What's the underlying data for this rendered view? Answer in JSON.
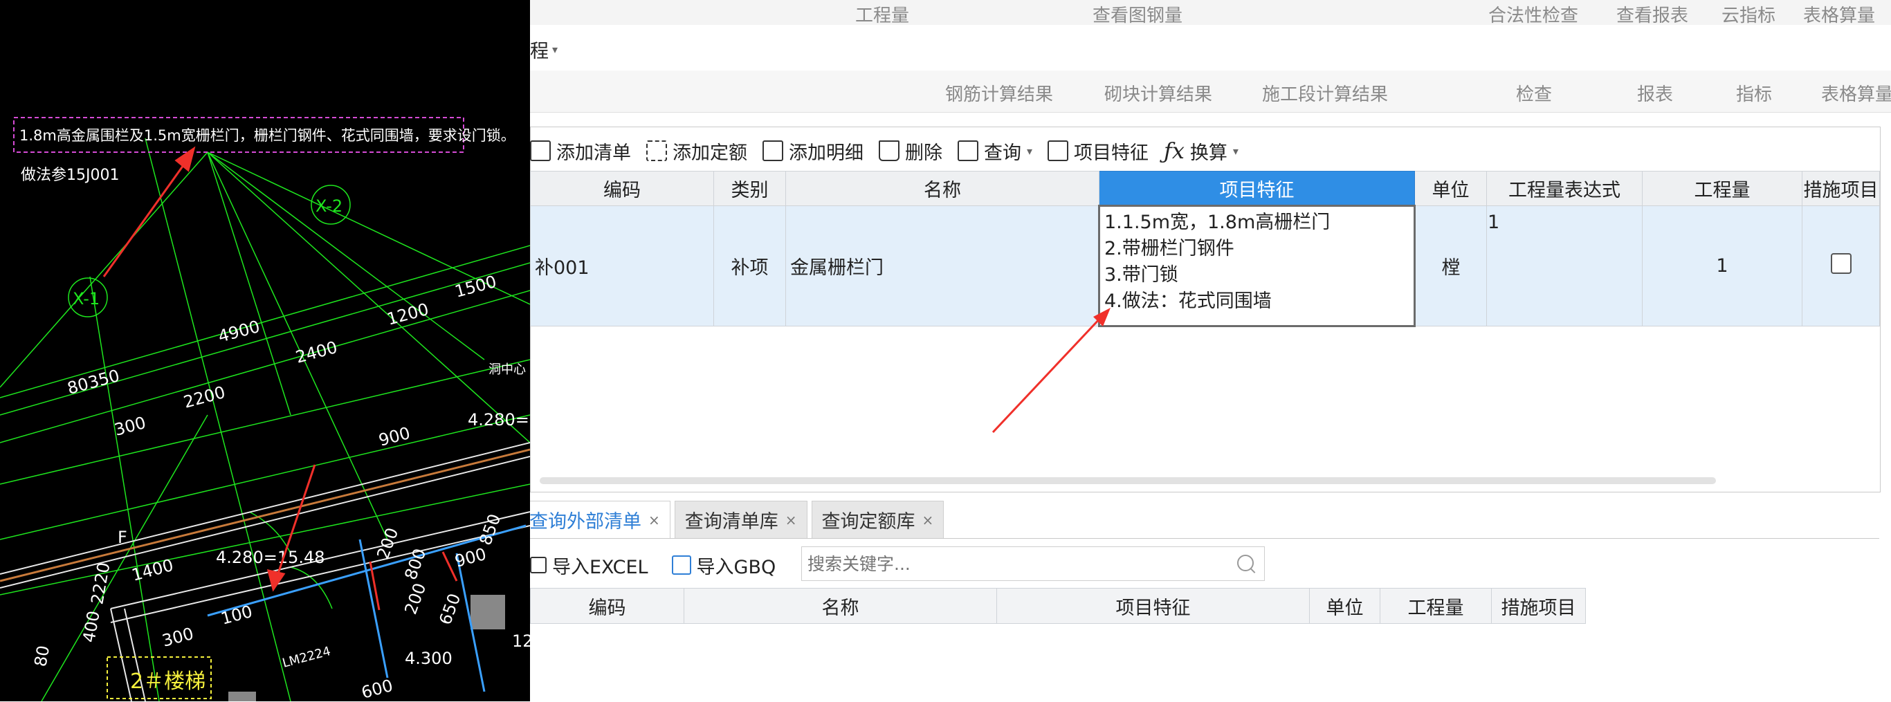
{
  "topbar": {
    "items": [
      "工程量",
      "查看图钢量",
      "合法性检查",
      "查看报表",
      "云指标",
      "表格算量"
    ],
    "row2_label": "程",
    "row3_items": [
      "钢筋计算结果",
      "砌块计算结果",
      "施工段计算结果",
      "检查",
      "报表",
      "指标",
      "表格算量"
    ]
  },
  "toolbar": {
    "add_list": "添加清单",
    "add_quota": "添加定额",
    "add_detail": "添加明细",
    "delete": "删除",
    "query": "查询",
    "item_feature": "项目特征",
    "convert": "换算"
  },
  "main_table": {
    "headers": [
      "编码",
      "类别",
      "名称",
      "项目特征",
      "单位",
      "工程量表达式",
      "工程量",
      "措施项目"
    ],
    "row": {
      "code": "补001",
      "type": "补项",
      "name": "金属栅栏门",
      "features": [
        "1.1.5m宽，1.8m高栅栏门",
        "2.带栅栏门钢件",
        "3.带门锁",
        "4.做法：花式同围墙"
      ],
      "unit": "樘",
      "expression": "1",
      "quantity": "1"
    }
  },
  "tabs": [
    {
      "label": "查询外部清单",
      "active": true
    },
    {
      "label": "查询清单库",
      "active": false
    },
    {
      "label": "查询定额库",
      "active": false
    }
  ],
  "bottom": {
    "import_excel": "导入EXCEL",
    "import_gbq": "导入GBQ",
    "search_placeholder": "搜索关键字...",
    "headers": [
      "编码",
      "名称",
      "项目特征",
      "单位",
      "工程量",
      "措施项目"
    ]
  },
  "cad": {
    "note": "1.8m高金属围栏及1.5m宽栅栏门，栅栏门钢件、花式同围墙，要求设门锁。",
    "ref": "做法参15J001",
    "axes": [
      "X-1",
      "X-2"
    ],
    "dims": [
      "1500",
      "1200",
      "4900",
      "2400",
      "80",
      "350",
      "2200",
      "300",
      "900",
      "4.280=",
      "F",
      "1400",
      "4.280=15.48",
      "2220",
      "850",
      "900",
      "800",
      "650",
      "200",
      "200",
      "300",
      "100",
      "LM2224",
      "4.300",
      "80",
      "400",
      "600",
      "12"
    ],
    "side_label": "洞中心",
    "stair_label": "2＃楼梯"
  },
  "colors": {
    "accent": "#2f8ee5",
    "row_selected": "#e3effa",
    "cad_bg": "#000000",
    "cad_green": "#1ee61e",
    "arrow_red": "#f0302a",
    "note_magenta": "#d64bd6"
  }
}
